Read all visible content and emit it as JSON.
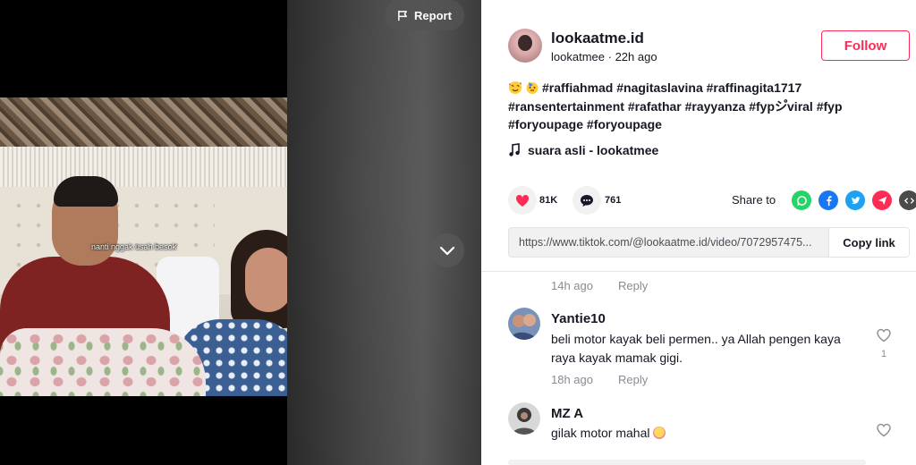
{
  "video": {
    "caption": "nanti nggak usah besok",
    "report_label": "Report"
  },
  "author": {
    "name": "lookaatme.id",
    "handle": "lookatmee",
    "time": "22h ago",
    "follow_label": "Follow"
  },
  "description": {
    "line1": "#raffiahmad #nagitaslavina #raffinagita1717",
    "line2": "#ransentertainment #rafathar #rayyanza #fypシ゚viral #fyp",
    "line3": "#foryoupage #foryoupage"
  },
  "music": {
    "title": "suara asli - lookatmee"
  },
  "actions": {
    "likes": "81K",
    "comments": "761",
    "share_label": "Share to"
  },
  "link": {
    "url": "https://www.tiktok.com/@lookaatme.id/video/7072957475...",
    "copy_label": "Copy link"
  },
  "comments": [
    {
      "time": "14h ago",
      "reply": "Reply"
    },
    {
      "name": "Yantie10",
      "text": "beli motor kayak beli permen.. ya Allah pengen kaya raya kayak mamak gigi.",
      "time": "18h ago",
      "reply": "Reply",
      "likes": "1"
    },
    {
      "name": "MZ A",
      "text": "gilak motor mahal"
    }
  ],
  "colors": {
    "accent": "#fe2c55",
    "whatsapp": "#25d366",
    "facebook": "#1877f2",
    "twitter": "#1da1f2",
    "telegram": "#fe2c55",
    "embed": "#4a4a4a"
  }
}
